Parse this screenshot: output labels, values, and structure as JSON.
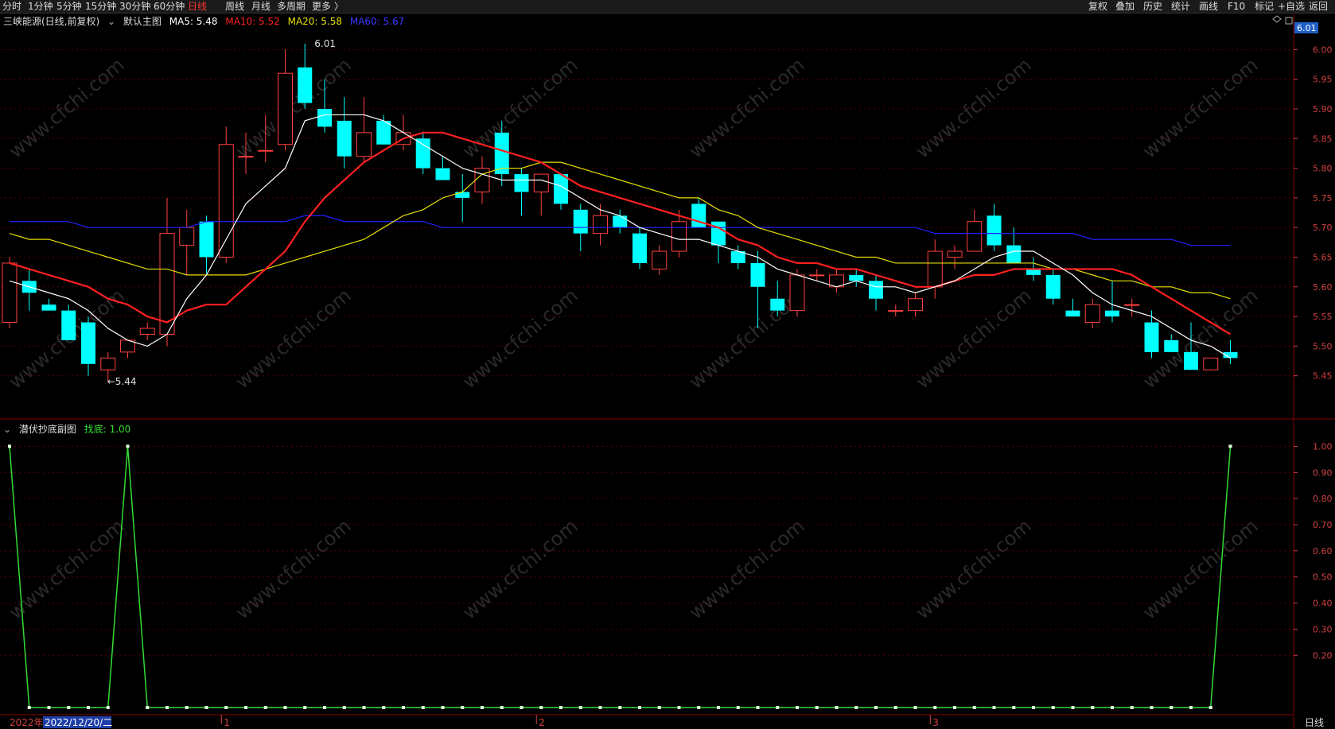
{
  "toolbar": {
    "periods": [
      "分时",
      "1分钟",
      "5分钟",
      "15分钟",
      "30分钟",
      "60分钟",
      "日线",
      "周线",
      "月线",
      "多周期",
      "更多 〉"
    ],
    "active_period": "日线",
    "right_items": [
      "复权",
      "叠加",
      "历史",
      "统计",
      "画线",
      "F10",
      "标记",
      "+自选",
      "返回"
    ]
  },
  "main_legend": {
    "stock": "三峡能源(日线,前复权)",
    "template": "默认主图",
    "ma5": "MA5: 5.48",
    "ma10": "MA10: 5.52",
    "ma20": "MA20: 5.58",
    "ma60": "MA60: 5.67"
  },
  "sub_legend": {
    "name": "潜伏抄底副图",
    "value_label": "找底: 1.00"
  },
  "price_tag": "6.01",
  "period_badge": "日线",
  "watermark": "www.cfchi.com",
  "bottom_axis": {
    "year": "2022年",
    "cursor_date": "2022/12/20/二",
    "months": [
      "1",
      "2",
      "3"
    ]
  },
  "colors": {
    "up": "#ff4040",
    "down": "#00ffff",
    "ma5": "#ffffff",
    "ma10": "#ff2020",
    "ma20": "#e8e000",
    "ma60": "#2020ff",
    "indicator": "#33dd33",
    "grid": "#8b0000"
  },
  "chart_data": [
    {
      "type": "candlestick",
      "ylim": [
        5.4,
        6.03
      ],
      "yticks": [
        6.0,
        5.95,
        5.9,
        5.85,
        5.8,
        5.75,
        5.7,
        5.65,
        5.6,
        5.55,
        5.5,
        5.45
      ],
      "annotations": [
        {
          "label": "6.01",
          "value": 6.01
        },
        {
          "label": "←5.44",
          "value": 5.44
        }
      ],
      "candles": [
        {
          "o": 5.54,
          "h": 5.65,
          "l": 5.53,
          "c": 5.64
        },
        {
          "o": 5.61,
          "h": 5.63,
          "l": 5.56,
          "c": 5.59
        },
        {
          "o": 5.57,
          "h": 5.58,
          "l": 5.56,
          "c": 5.56
        },
        {
          "o": 5.56,
          "h": 5.57,
          "l": 5.51,
          "c": 5.51
        },
        {
          "o": 5.54,
          "h": 5.55,
          "l": 5.45,
          "c": 5.47
        },
        {
          "o": 5.46,
          "h": 5.49,
          "l": 5.44,
          "c": 5.48
        },
        {
          "o": 5.49,
          "h": 5.51,
          "l": 5.48,
          "c": 5.51
        },
        {
          "o": 5.52,
          "h": 5.54,
          "l": 5.51,
          "c": 5.53
        },
        {
          "o": 5.52,
          "h": 5.75,
          "l": 5.5,
          "c": 5.69
        },
        {
          "o": 5.67,
          "h": 5.73,
          "l": 5.62,
          "c": 5.7
        },
        {
          "o": 5.71,
          "h": 5.72,
          "l": 5.62,
          "c": 5.65
        },
        {
          "o": 5.65,
          "h": 5.87,
          "l": 5.64,
          "c": 5.84
        },
        {
          "o": 5.82,
          "h": 5.86,
          "l": 5.79,
          "c": 5.82
        },
        {
          "o": 5.83,
          "h": 5.89,
          "l": 5.81,
          "c": 5.83
        },
        {
          "o": 5.84,
          "h": 6.0,
          "l": 5.83,
          "c": 5.96
        },
        {
          "o": 5.97,
          "h": 6.01,
          "l": 5.9,
          "c": 5.91
        },
        {
          "o": 5.9,
          "h": 5.95,
          "l": 5.86,
          "c": 5.87
        },
        {
          "o": 5.88,
          "h": 5.92,
          "l": 5.8,
          "c": 5.82
        },
        {
          "o": 5.82,
          "h": 5.92,
          "l": 5.81,
          "c": 5.86
        },
        {
          "o": 5.88,
          "h": 5.89,
          "l": 5.84,
          "c": 5.84
        },
        {
          "o": 5.84,
          "h": 5.89,
          "l": 5.83,
          "c": 5.86
        },
        {
          "o": 5.85,
          "h": 5.86,
          "l": 5.79,
          "c": 5.8
        },
        {
          "o": 5.8,
          "h": 5.82,
          "l": 5.78,
          "c": 5.78
        },
        {
          "o": 5.76,
          "h": 5.79,
          "l": 5.71,
          "c": 5.75
        },
        {
          "o": 5.76,
          "h": 5.82,
          "l": 5.74,
          "c": 5.8
        },
        {
          "o": 5.86,
          "h": 5.88,
          "l": 5.77,
          "c": 5.79
        },
        {
          "o": 5.79,
          "h": 5.8,
          "l": 5.72,
          "c": 5.76
        },
        {
          "o": 5.76,
          "h": 5.79,
          "l": 5.72,
          "c": 5.79
        },
        {
          "o": 5.79,
          "h": 5.79,
          "l": 5.73,
          "c": 5.74
        },
        {
          "o": 5.73,
          "h": 5.74,
          "l": 5.66,
          "c": 5.69
        },
        {
          "o": 5.69,
          "h": 5.74,
          "l": 5.67,
          "c": 5.72
        },
        {
          "o": 5.72,
          "h": 5.73,
          "l": 5.69,
          "c": 5.7
        },
        {
          "o": 5.69,
          "h": 5.7,
          "l": 5.63,
          "c": 5.64
        },
        {
          "o": 5.63,
          "h": 5.67,
          "l": 5.62,
          "c": 5.66
        },
        {
          "o": 5.66,
          "h": 5.73,
          "l": 5.65,
          "c": 5.71
        },
        {
          "o": 5.74,
          "h": 5.75,
          "l": 5.7,
          "c": 5.7
        },
        {
          "o": 5.71,
          "h": 5.71,
          "l": 5.64,
          "c": 5.67
        },
        {
          "o": 5.66,
          "h": 5.67,
          "l": 5.63,
          "c": 5.64
        },
        {
          "o": 5.64,
          "h": 5.66,
          "l": 5.53,
          "c": 5.6
        },
        {
          "o": 5.58,
          "h": 5.61,
          "l": 5.55,
          "c": 5.56
        },
        {
          "o": 5.56,
          "h": 5.63,
          "l": 5.55,
          "c": 5.62
        },
        {
          "o": 5.62,
          "h": 5.63,
          "l": 5.61,
          "c": 5.62
        },
        {
          "o": 5.6,
          "h": 5.63,
          "l": 5.59,
          "c": 5.62
        },
        {
          "o": 5.62,
          "h": 5.63,
          "l": 5.6,
          "c": 5.61
        },
        {
          "o": 5.61,
          "h": 5.62,
          "l": 5.56,
          "c": 5.58
        },
        {
          "o": 5.56,
          "h": 5.57,
          "l": 5.55,
          "c": 5.56
        },
        {
          "o": 5.56,
          "h": 5.59,
          "l": 5.55,
          "c": 5.58
        },
        {
          "o": 5.6,
          "h": 5.68,
          "l": 5.58,
          "c": 5.66
        },
        {
          "o": 5.65,
          "h": 5.67,
          "l": 5.63,
          "c": 5.66
        },
        {
          "o": 5.66,
          "h": 5.73,
          "l": 5.66,
          "c": 5.71
        },
        {
          "o": 5.72,
          "h": 5.74,
          "l": 5.66,
          "c": 5.67
        },
        {
          "o": 5.67,
          "h": 5.7,
          "l": 5.64,
          "c": 5.64
        },
        {
          "o": 5.63,
          "h": 5.65,
          "l": 5.61,
          "c": 5.62
        },
        {
          "o": 5.62,
          "h": 5.63,
          "l": 5.57,
          "c": 5.58
        },
        {
          "o": 5.56,
          "h": 5.58,
          "l": 5.55,
          "c": 5.55
        },
        {
          "o": 5.54,
          "h": 5.58,
          "l": 5.53,
          "c": 5.57
        },
        {
          "o": 5.56,
          "h": 5.61,
          "l": 5.54,
          "c": 5.55
        },
        {
          "o": 5.57,
          "h": 5.58,
          "l": 5.55,
          "c": 5.57
        },
        {
          "o": 5.54,
          "h": 5.56,
          "l": 5.48,
          "c": 5.49
        },
        {
          "o": 5.51,
          "h": 5.52,
          "l": 5.49,
          "c": 5.49
        },
        {
          "o": 5.49,
          "h": 5.54,
          "l": 5.46,
          "c": 5.46
        },
        {
          "o": 5.46,
          "h": 5.48,
          "l": 5.46,
          "c": 5.48
        },
        {
          "o": 5.49,
          "h": 5.51,
          "l": 5.47,
          "c": 5.48
        }
      ],
      "ma5": [
        5.61,
        5.6,
        5.59,
        5.58,
        5.56,
        5.53,
        5.51,
        5.5,
        5.52,
        5.58,
        5.62,
        5.68,
        5.74,
        5.77,
        5.8,
        5.88,
        5.89,
        5.89,
        5.89,
        5.88,
        5.86,
        5.84,
        5.82,
        5.8,
        5.79,
        5.78,
        5.78,
        5.78,
        5.77,
        5.75,
        5.73,
        5.72,
        5.7,
        5.69,
        5.68,
        5.68,
        5.67,
        5.66,
        5.65,
        5.63,
        5.62,
        5.61,
        5.6,
        5.61,
        5.6,
        5.6,
        5.59,
        5.6,
        5.61,
        5.63,
        5.65,
        5.66,
        5.66,
        5.64,
        5.62,
        5.59,
        5.57,
        5.56,
        5.55,
        5.53,
        5.51,
        5.5,
        5.48
      ],
      "ma10": [
        5.64,
        5.63,
        5.62,
        5.61,
        5.6,
        5.58,
        5.57,
        5.55,
        5.54,
        5.56,
        5.57,
        5.57,
        5.6,
        5.63,
        5.66,
        5.71,
        5.75,
        5.78,
        5.81,
        5.83,
        5.85,
        5.86,
        5.86,
        5.85,
        5.84,
        5.83,
        5.82,
        5.81,
        5.79,
        5.77,
        5.76,
        5.75,
        5.74,
        5.73,
        5.72,
        5.71,
        5.7,
        5.68,
        5.67,
        5.65,
        5.64,
        5.64,
        5.63,
        5.63,
        5.62,
        5.61,
        5.6,
        5.6,
        5.61,
        5.62,
        5.62,
        5.63,
        5.63,
        5.63,
        5.63,
        5.63,
        5.63,
        5.62,
        5.6,
        5.58,
        5.56,
        5.54,
        5.52
      ],
      "ma20": [
        5.69,
        5.68,
        5.68,
        5.67,
        5.66,
        5.65,
        5.64,
        5.63,
        5.63,
        5.62,
        5.62,
        5.62,
        5.62,
        5.63,
        5.64,
        5.65,
        5.66,
        5.67,
        5.68,
        5.7,
        5.72,
        5.73,
        5.75,
        5.76,
        5.79,
        5.8,
        5.8,
        5.81,
        5.81,
        5.8,
        5.79,
        5.78,
        5.77,
        5.76,
        5.75,
        5.75,
        5.73,
        5.72,
        5.7,
        5.69,
        5.68,
        5.67,
        5.66,
        5.65,
        5.65,
        5.64,
        5.64,
        5.64,
        5.64,
        5.64,
        5.64,
        5.64,
        5.64,
        5.63,
        5.63,
        5.62,
        5.61,
        5.61,
        5.6,
        5.6,
        5.59,
        5.59,
        5.58
      ],
      "ma60": [
        5.71,
        5.71,
        5.71,
        5.71,
        5.7,
        5.7,
        5.7,
        5.7,
        5.7,
        5.7,
        5.71,
        5.71,
        5.71,
        5.71,
        5.71,
        5.72,
        5.72,
        5.71,
        5.71,
        5.71,
        5.71,
        5.71,
        5.7,
        5.7,
        5.7,
        5.7,
        5.7,
        5.7,
        5.7,
        5.7,
        5.7,
        5.7,
        5.7,
        5.7,
        5.7,
        5.7,
        5.7,
        5.7,
        5.7,
        5.7,
        5.7,
        5.7,
        5.7,
        5.7,
        5.7,
        5.7,
        5.7,
        5.69,
        5.69,
        5.69,
        5.69,
        5.69,
        5.69,
        5.69,
        5.69,
        5.68,
        5.68,
        5.68,
        5.68,
        5.68,
        5.67,
        5.67,
        5.67
      ]
    },
    {
      "type": "line",
      "name": "找底",
      "ylim": [
        0,
        1.05
      ],
      "yticks": [
        1.0,
        0.9,
        0.8,
        0.7,
        0.6,
        0.5,
        0.4,
        0.3,
        0.2
      ],
      "values": [
        1,
        0,
        0,
        0,
        0,
        0,
        1,
        0,
        0,
        0,
        0,
        0,
        0,
        0,
        0,
        0,
        0,
        0,
        0,
        0,
        0,
        0,
        0,
        0,
        0,
        0,
        0,
        0,
        0,
        0,
        0,
        0,
        0,
        0,
        0,
        0,
        0,
        0,
        0,
        0,
        0,
        0,
        0,
        0,
        0,
        0,
        0,
        0,
        0,
        0,
        0,
        0,
        0,
        0,
        0,
        0,
        0,
        0,
        0,
        0,
        0,
        0,
        1
      ]
    }
  ]
}
